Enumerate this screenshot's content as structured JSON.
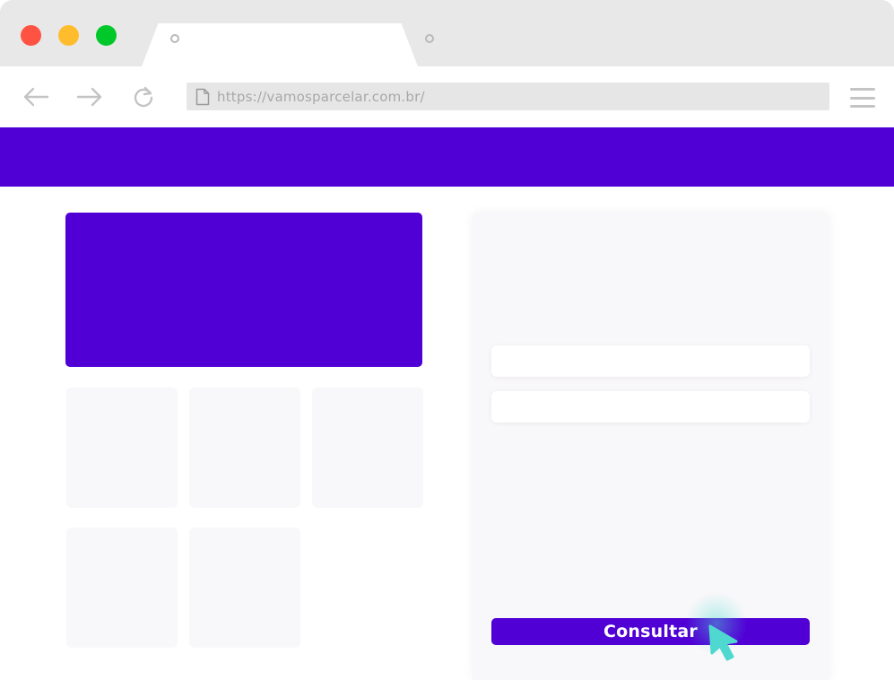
{
  "browser": {
    "window_controls": [
      "close",
      "minimize",
      "maximize"
    ],
    "address_bar": {
      "url": "https://vamosparcelar.com.br/"
    },
    "icons": {
      "back": "arrow-left-icon",
      "forward": "arrow-right-icon",
      "reload": "reload-icon",
      "page": "page-icon",
      "menu": "hamburger-menu-icon"
    }
  },
  "page": {
    "form": {
      "submit_label": "Consultar"
    }
  },
  "colors": {
    "brand": "#5000d5",
    "close": "#fe5343",
    "minimize": "#ffbd2e",
    "maximize": "#00c82a",
    "cursor": "#4fd8cf"
  }
}
